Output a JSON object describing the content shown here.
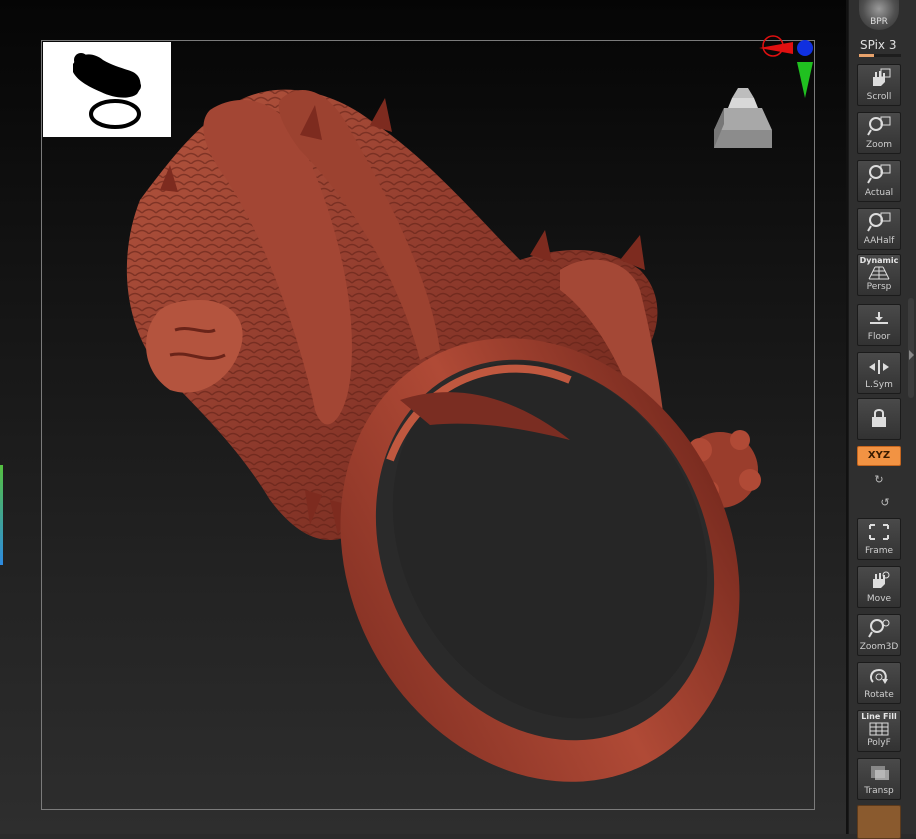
{
  "shelf": {
    "bpr": {
      "label": "BPR",
      "icon": "bpr-sphere-icon"
    },
    "spix": {
      "label": "SPix 3",
      "level": 0.35
    },
    "buttons": [
      {
        "id": "scroll",
        "label": "Scroll",
        "icon": "hand-scroll-icon"
      },
      {
        "id": "zoom",
        "label": "Zoom",
        "icon": "magnifier-zoom-icon"
      },
      {
        "id": "actual",
        "label": "Actual",
        "icon": "magnifier-actual-icon"
      },
      {
        "id": "aahalf",
        "label": "AAHalf",
        "icon": "magnifier-aahalf-icon"
      },
      {
        "id": "persp",
        "label": "Persp",
        "top_label": "Dynamic",
        "icon": "perspective-grid-icon"
      },
      {
        "id": "floor",
        "label": "Floor",
        "icon": "floor-icon"
      },
      {
        "id": "lsym",
        "label": "L.Sym",
        "icon": "symmetry-icon"
      },
      {
        "id": "lock",
        "label": "",
        "icon": "lock-icon"
      },
      {
        "id": "xyz",
        "label": "XYZ",
        "icon": "xyz-rotate-icon",
        "active": true
      },
      {
        "id": "frame",
        "label": "Frame",
        "icon": "frame-icon"
      },
      {
        "id": "move",
        "label": "Move",
        "icon": "hand-move-icon"
      },
      {
        "id": "zoom3d",
        "label": "Zoom3D",
        "icon": "zoom3d-icon"
      },
      {
        "id": "rotate",
        "label": "Rotate",
        "icon": "rotate-icon"
      },
      {
        "id": "polyf",
        "label": "PolyF",
        "top_label": "Line Fill",
        "icon": "polyframe-grid-icon"
      },
      {
        "id": "transp",
        "label": "Transp",
        "icon": "transparency-icon"
      }
    ]
  },
  "viewport": {
    "model": "dragon-ring-sculpt",
    "model_color": "#8e3a2c",
    "gyro_colors": {
      "x": "#e01010",
      "y": "#20c020",
      "z": "#1030e0"
    }
  },
  "colors": {
    "accent": "#f29343",
    "panel": "#2f2f2f"
  }
}
